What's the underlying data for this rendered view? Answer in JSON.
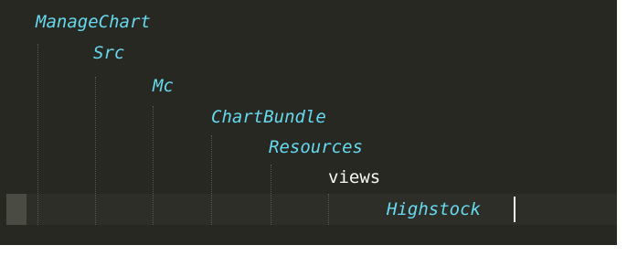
{
  "editor": {
    "lines": [
      {
        "text": "ManageChart"
      },
      {
        "text": "Src"
      },
      {
        "text": "Mc"
      },
      {
        "text": "ChartBundle"
      },
      {
        "text": "Resources"
      },
      {
        "text": "views"
      },
      {
        "text": "Highstock"
      }
    ]
  },
  "colors": {
    "background": "#272822",
    "tag_text": "#66d9ef",
    "plain_text": "#f8f8f2",
    "current_line": "#2d2e27",
    "gutter_marker": "#4a4b43"
  }
}
